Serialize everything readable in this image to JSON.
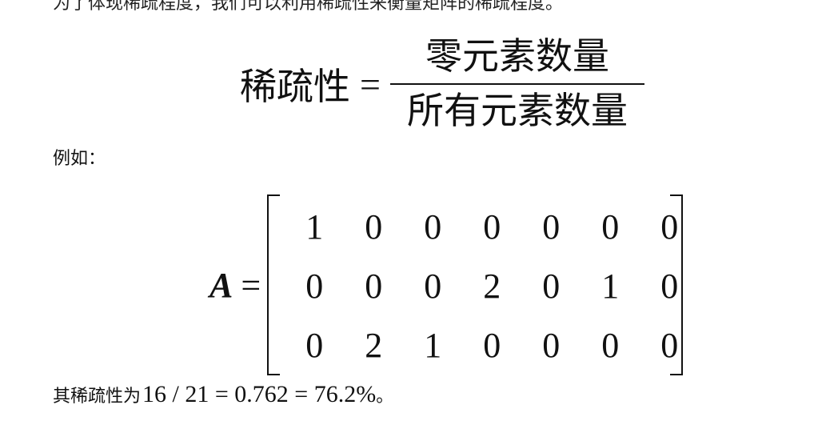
{
  "top_line": "为了体现稀疏程度，我们可以利用稀疏性来衡量矩阵的稀疏程度。",
  "formula": {
    "lhs": "稀疏性",
    "equals": "=",
    "numerator": "零元素数量",
    "denominator": "所有元素数量"
  },
  "example_label": "例如：",
  "matrix": {
    "name": "A",
    "equals": "=",
    "rows": [
      [
        "1",
        "0",
        "0",
        "0",
        "0",
        "0",
        "0"
      ],
      [
        "0",
        "0",
        "0",
        "2",
        "0",
        "1",
        "0"
      ],
      [
        "0",
        "2",
        "1",
        "0",
        "0",
        "0",
        "0"
      ]
    ]
  },
  "result": {
    "prefix": "其稀疏性为",
    "expression": "16 / 21 = 0.762 = 76.2%",
    "suffix": "。"
  }
}
